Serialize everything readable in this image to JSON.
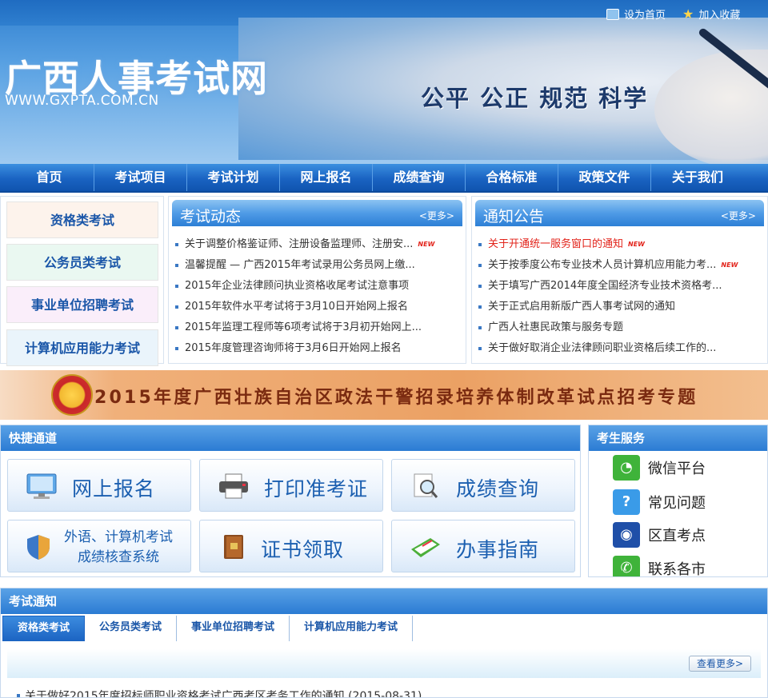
{
  "header": {
    "set_home": "设为首页",
    "add_favorite": "加入收藏",
    "site_title": "广西人事考试网",
    "site_url": "WWW.GXPTA.COM.CN",
    "slogan": "公平 公正 规范 科学"
  },
  "nav": [
    "首页",
    "考试项目",
    "考试计划",
    "网上报名",
    "成绩查询",
    "合格标准",
    "政策文件",
    "关于我们"
  ],
  "categories": [
    {
      "label": "资格类考试",
      "color": "#fdf3ec"
    },
    {
      "label": "公务员类考试",
      "color": "#eaf8f1"
    },
    {
      "label": "事业单位招聘考试",
      "color": "#faeefa"
    },
    {
      "label": "计算机应用能力考试",
      "color": "#eaf4fb"
    }
  ],
  "exam_news": {
    "title": "考试动态",
    "more": "<更多>",
    "items": [
      {
        "text": "关于调整价格鉴证师、注册设备监理师、注册安...",
        "new": "NEW"
      },
      {
        "text": "温馨提醒 — 广西2015年考试录用公务员网上缴..."
      },
      {
        "text": "2015年企业法律顾问执业资格收尾考试注意事项"
      },
      {
        "text": "2015年软件水平考试将于3月10日开始网上报名"
      },
      {
        "text": "2015年监理工程师等6项考试将于3月初开始网上..."
      },
      {
        "text": "2015年度管理咨询师将于3月6日开始网上报名"
      }
    ]
  },
  "announcements": {
    "title": "通知公告",
    "more": "<更多>",
    "items": [
      {
        "text": "关于开通统一服务窗口的通知",
        "new": "NEW",
        "hot": true
      },
      {
        "text": "关于按季度公布专业技术人员计算机应用能力考...",
        "new": "NEW"
      },
      {
        "text": "关于填写广西2014年度全国经济专业技术资格考..."
      },
      {
        "text": "关于正式启用新版广西人事考试网的通知"
      },
      {
        "text": "广西人社惠民政策与服务专题"
      },
      {
        "text": "关于做好取消企业法律顾问职业资格后续工作的..."
      }
    ]
  },
  "banner": {
    "text": "2015年度广西壮族自治区政法干警招录培养体制改革试点招考专题"
  },
  "quick": {
    "title": "快捷通道",
    "buttons": [
      {
        "label": "网上报名",
        "icon": "monitor-icon"
      },
      {
        "label": "打印准考证",
        "icon": "printer-icon"
      },
      {
        "label": "成绩查询",
        "icon": "magnifier-doc-icon"
      },
      {
        "line1": "外语、计算机考试",
        "line2": "成绩核查系统",
        "icon": "shield-icon"
      },
      {
        "label": "证书领取",
        "icon": "certificate-book-icon"
      },
      {
        "label": "办事指南",
        "icon": "notebook-icon"
      }
    ]
  },
  "services": {
    "title": "考生服务",
    "items": [
      {
        "label": "微信平台",
        "icon": "wechat-icon",
        "color": "#3fb33a"
      },
      {
        "label": "常见问题",
        "icon": "question-icon",
        "color": "#3a9be8"
      },
      {
        "label": "区直考点",
        "icon": "location-icon",
        "color": "#1f4fa8"
      },
      {
        "label": "联系各市",
        "icon": "phone-icon",
        "color": "#3fb33a"
      }
    ]
  },
  "notice": {
    "title": "考试通知",
    "tabs": [
      "资格类考试",
      "公务员类考试",
      "事业单位招聘考试",
      "计算机应用能力考试"
    ],
    "see_more": "查看更多>",
    "first_item": "关于做好2015年度招标师职业资格考试广西考区考务工作的通知 (2015-08-31)"
  }
}
